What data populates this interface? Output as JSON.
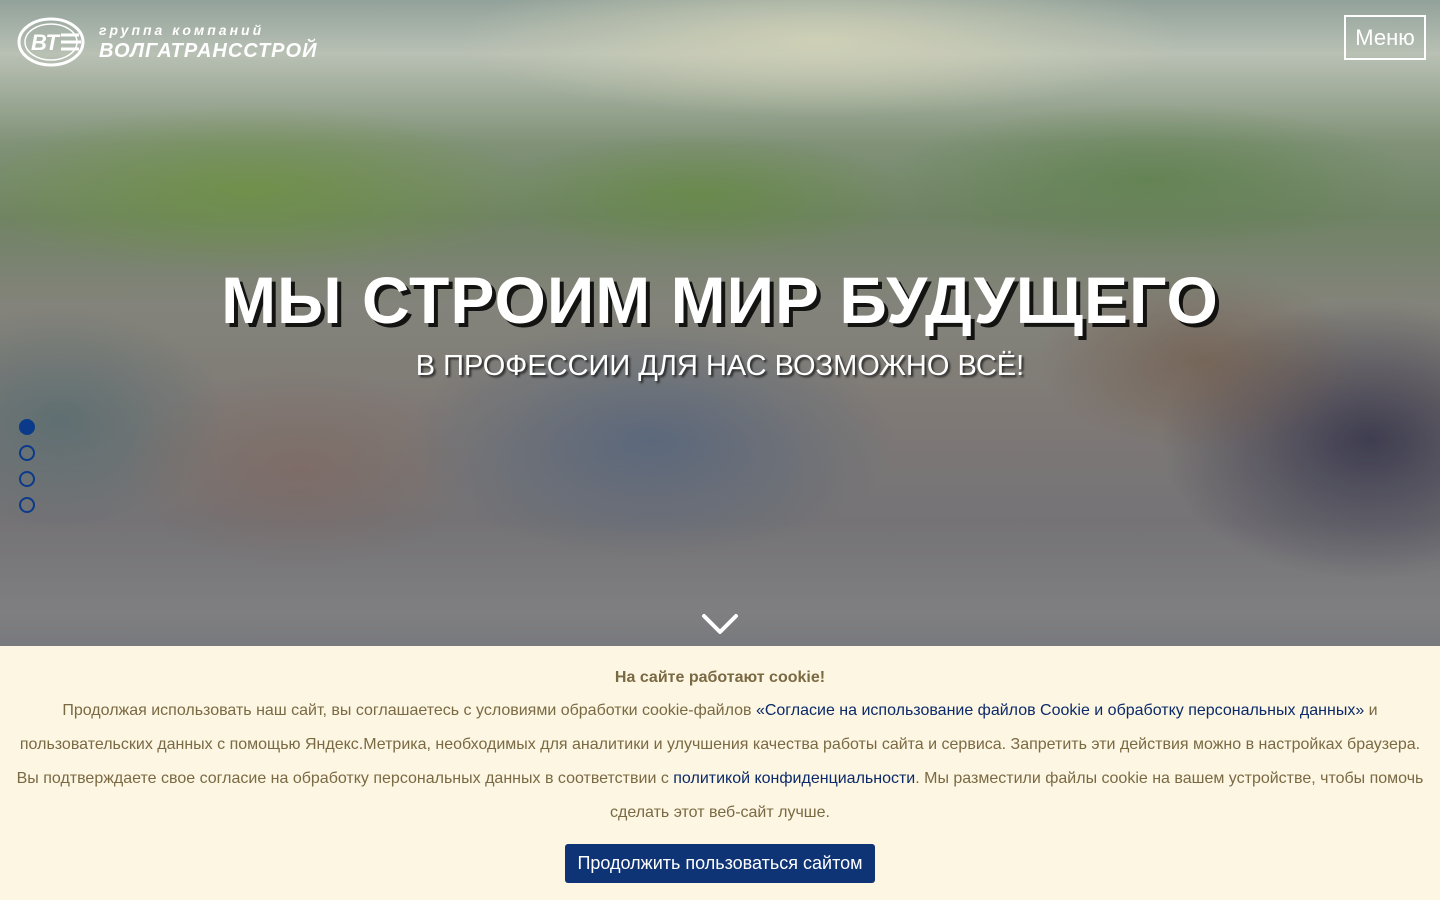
{
  "header": {
    "logo_line1": "группа компаний",
    "logo_line2": "ВОЛГАТРАНССТРОЙ",
    "menu_label": "Меню"
  },
  "hero": {
    "title": "МЫ СТРОИМ МИР БУДУЩЕГО",
    "subtitle": "В ПРОФЕССИИ ДЛЯ НАС ВОЗМОЖНО ВСЁ!",
    "slides_total": 4,
    "active_slide": 1
  },
  "cookie": {
    "title": "На сайте работают cookie!",
    "text_1": "Продолжая использовать наш сайт, вы соглашаетесь с условиями обработки cookie-файлов ",
    "link_1": "«Согласие на использование файлов Cookie и обработку персональных данных»",
    "text_2": " и пользовательских данных с помощью Яндекс.Метрика, необходимых для аналитики и улучшения качества работы сайта и сервиса. Запретить эти действия можно в настройках браузера. Вы подтверждаете свое согласие на обработку персональных данных в соответствии с ",
    "link_2": "политикой конфиденциальности",
    "text_3": ". Мы разместили файлы cookie на вашем устройстве, чтобы помочь сделать этот веб-сайт лучше.",
    "button_label": "Продолжить пользоваться сайтом"
  },
  "colors": {
    "accent": "#0f3475",
    "cookie_bg": "#fdf6e2",
    "cookie_text": "#7a6a44",
    "link": "#0b2a6a"
  },
  "icons": {
    "logo": "vts-logo-icon",
    "scroll": "chevron-down-icon"
  }
}
